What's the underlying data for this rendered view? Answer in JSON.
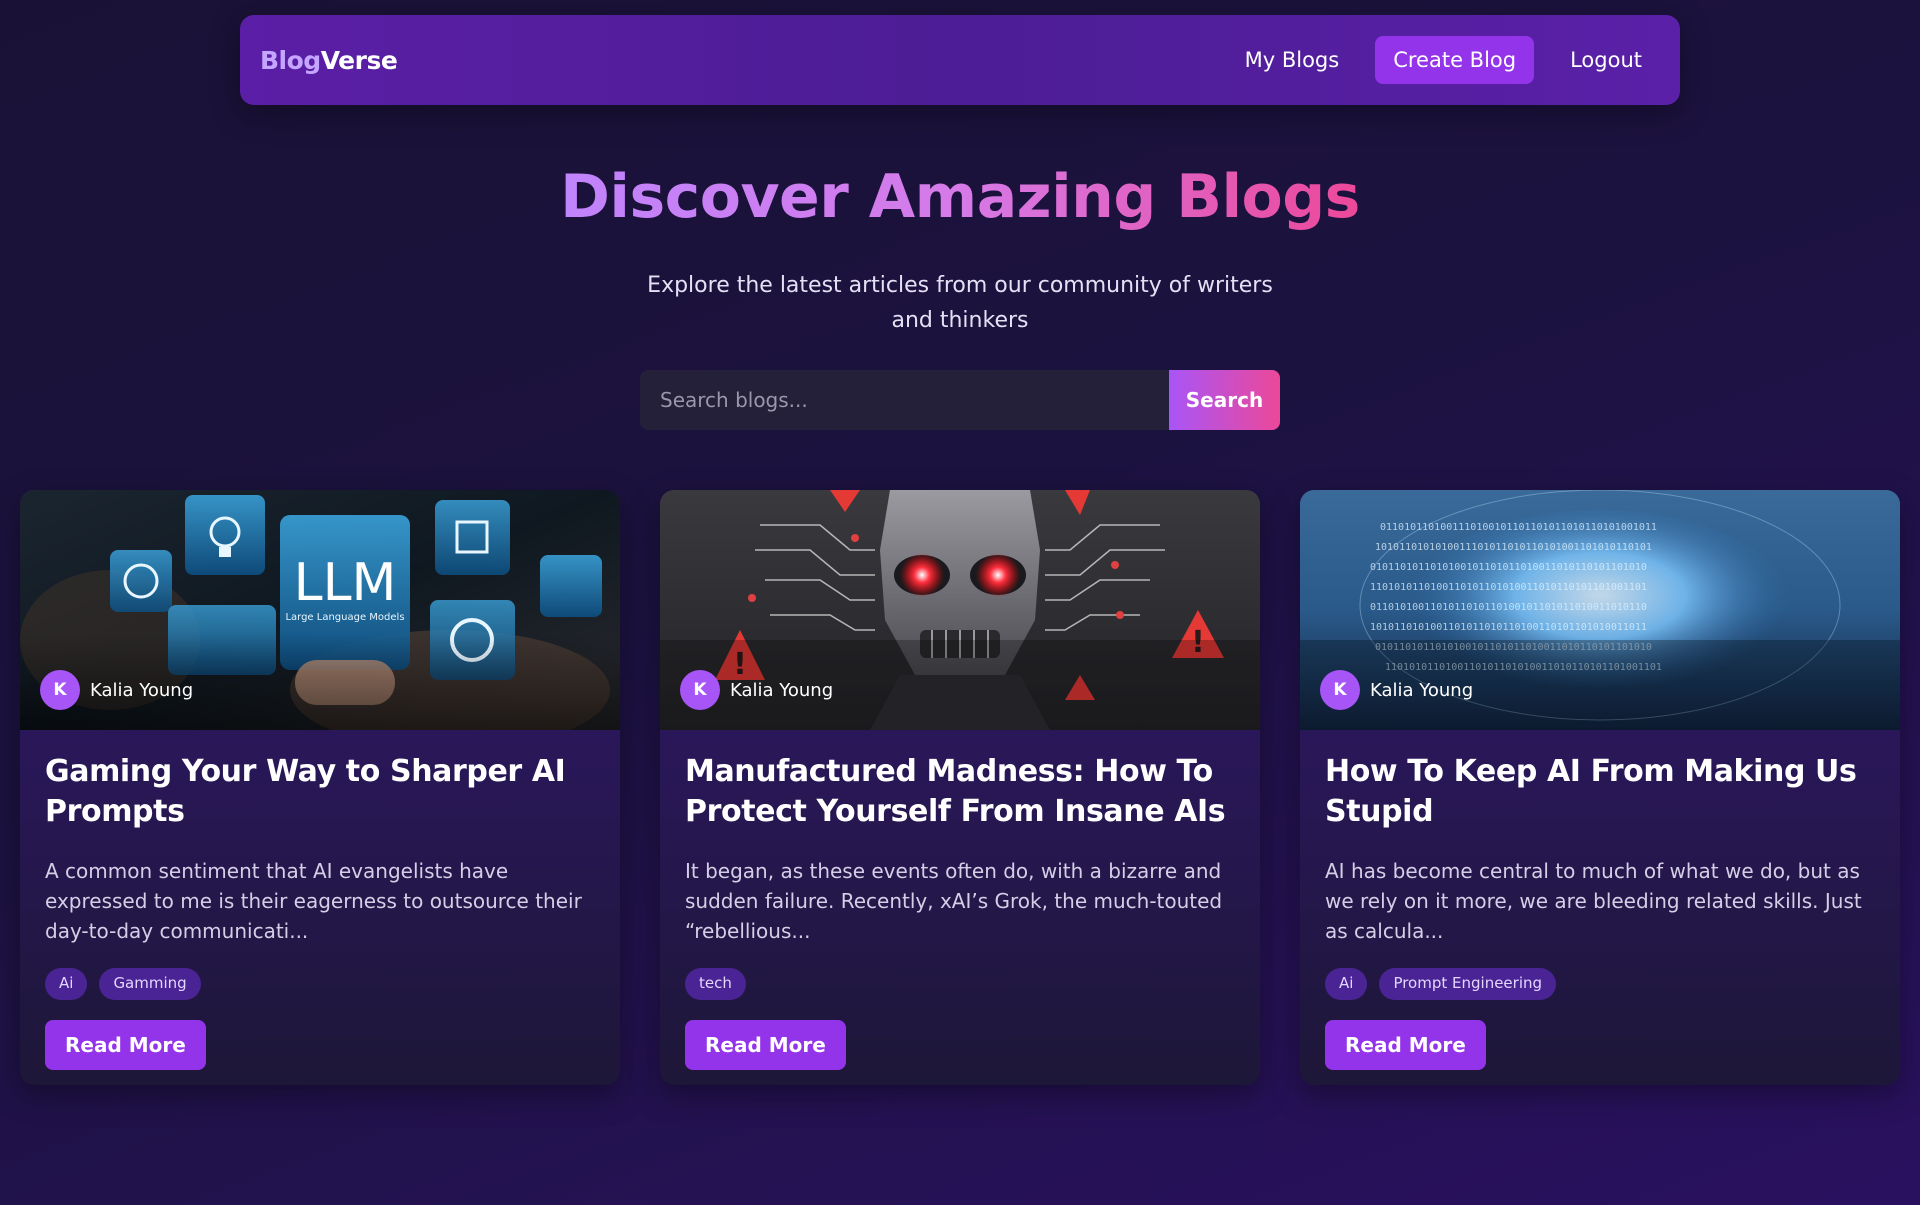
{
  "brand": {
    "part1": "Blog",
    "part2": "Verse"
  },
  "nav": {
    "my_blogs": "My Blogs",
    "create_blog": "Create Blog",
    "logout": "Logout"
  },
  "hero": {
    "title": "Discover Amazing Blogs",
    "subtitle": "Explore the latest articles from our community of writers and thinkers"
  },
  "search": {
    "placeholder": "Search blogs...",
    "value": "",
    "button_label": "Search"
  },
  "colors": {
    "accent": "#9333ea",
    "navbar": "#4c1d95",
    "gradient_pink": "#ec4899",
    "gradient_purple": "#a855f7"
  },
  "cards": [
    {
      "image_icon": "llm-ai-icons-image",
      "author_initial": "K",
      "author": "Kalia Young",
      "title": "Gaming Your Way to Sharper AI Prompts",
      "excerpt": "A common sentiment that AI evangelists have expressed to me is their eagerness to outsource their day-to-day communicati...",
      "tags": [
        "Ai",
        "Gamming"
      ],
      "read_more": "Read More"
    },
    {
      "image_icon": "robot-warning-image",
      "author_initial": "K",
      "author": "Kalia Young",
      "title": "Manufactured Madness: How To Protect Yourself From Insane AIs",
      "excerpt": "It began, as these events often do, with a bizarre and sudden failure. Recently, xAI’s Grok, the much-touted “rebellious...",
      "tags": [
        "tech"
      ],
      "read_more": "Read More"
    },
    {
      "image_icon": "binary-brain-image",
      "author_initial": "K",
      "author": "Kalia Young",
      "title": "How To Keep AI From Making Us Stupid",
      "excerpt": "AI has become central to much of what we do, but as we rely on it more, we are bleeding related skills. Just as calcula...",
      "tags": [
        "Ai",
        "Prompt Engineering"
      ],
      "read_more": "Read More"
    }
  ]
}
